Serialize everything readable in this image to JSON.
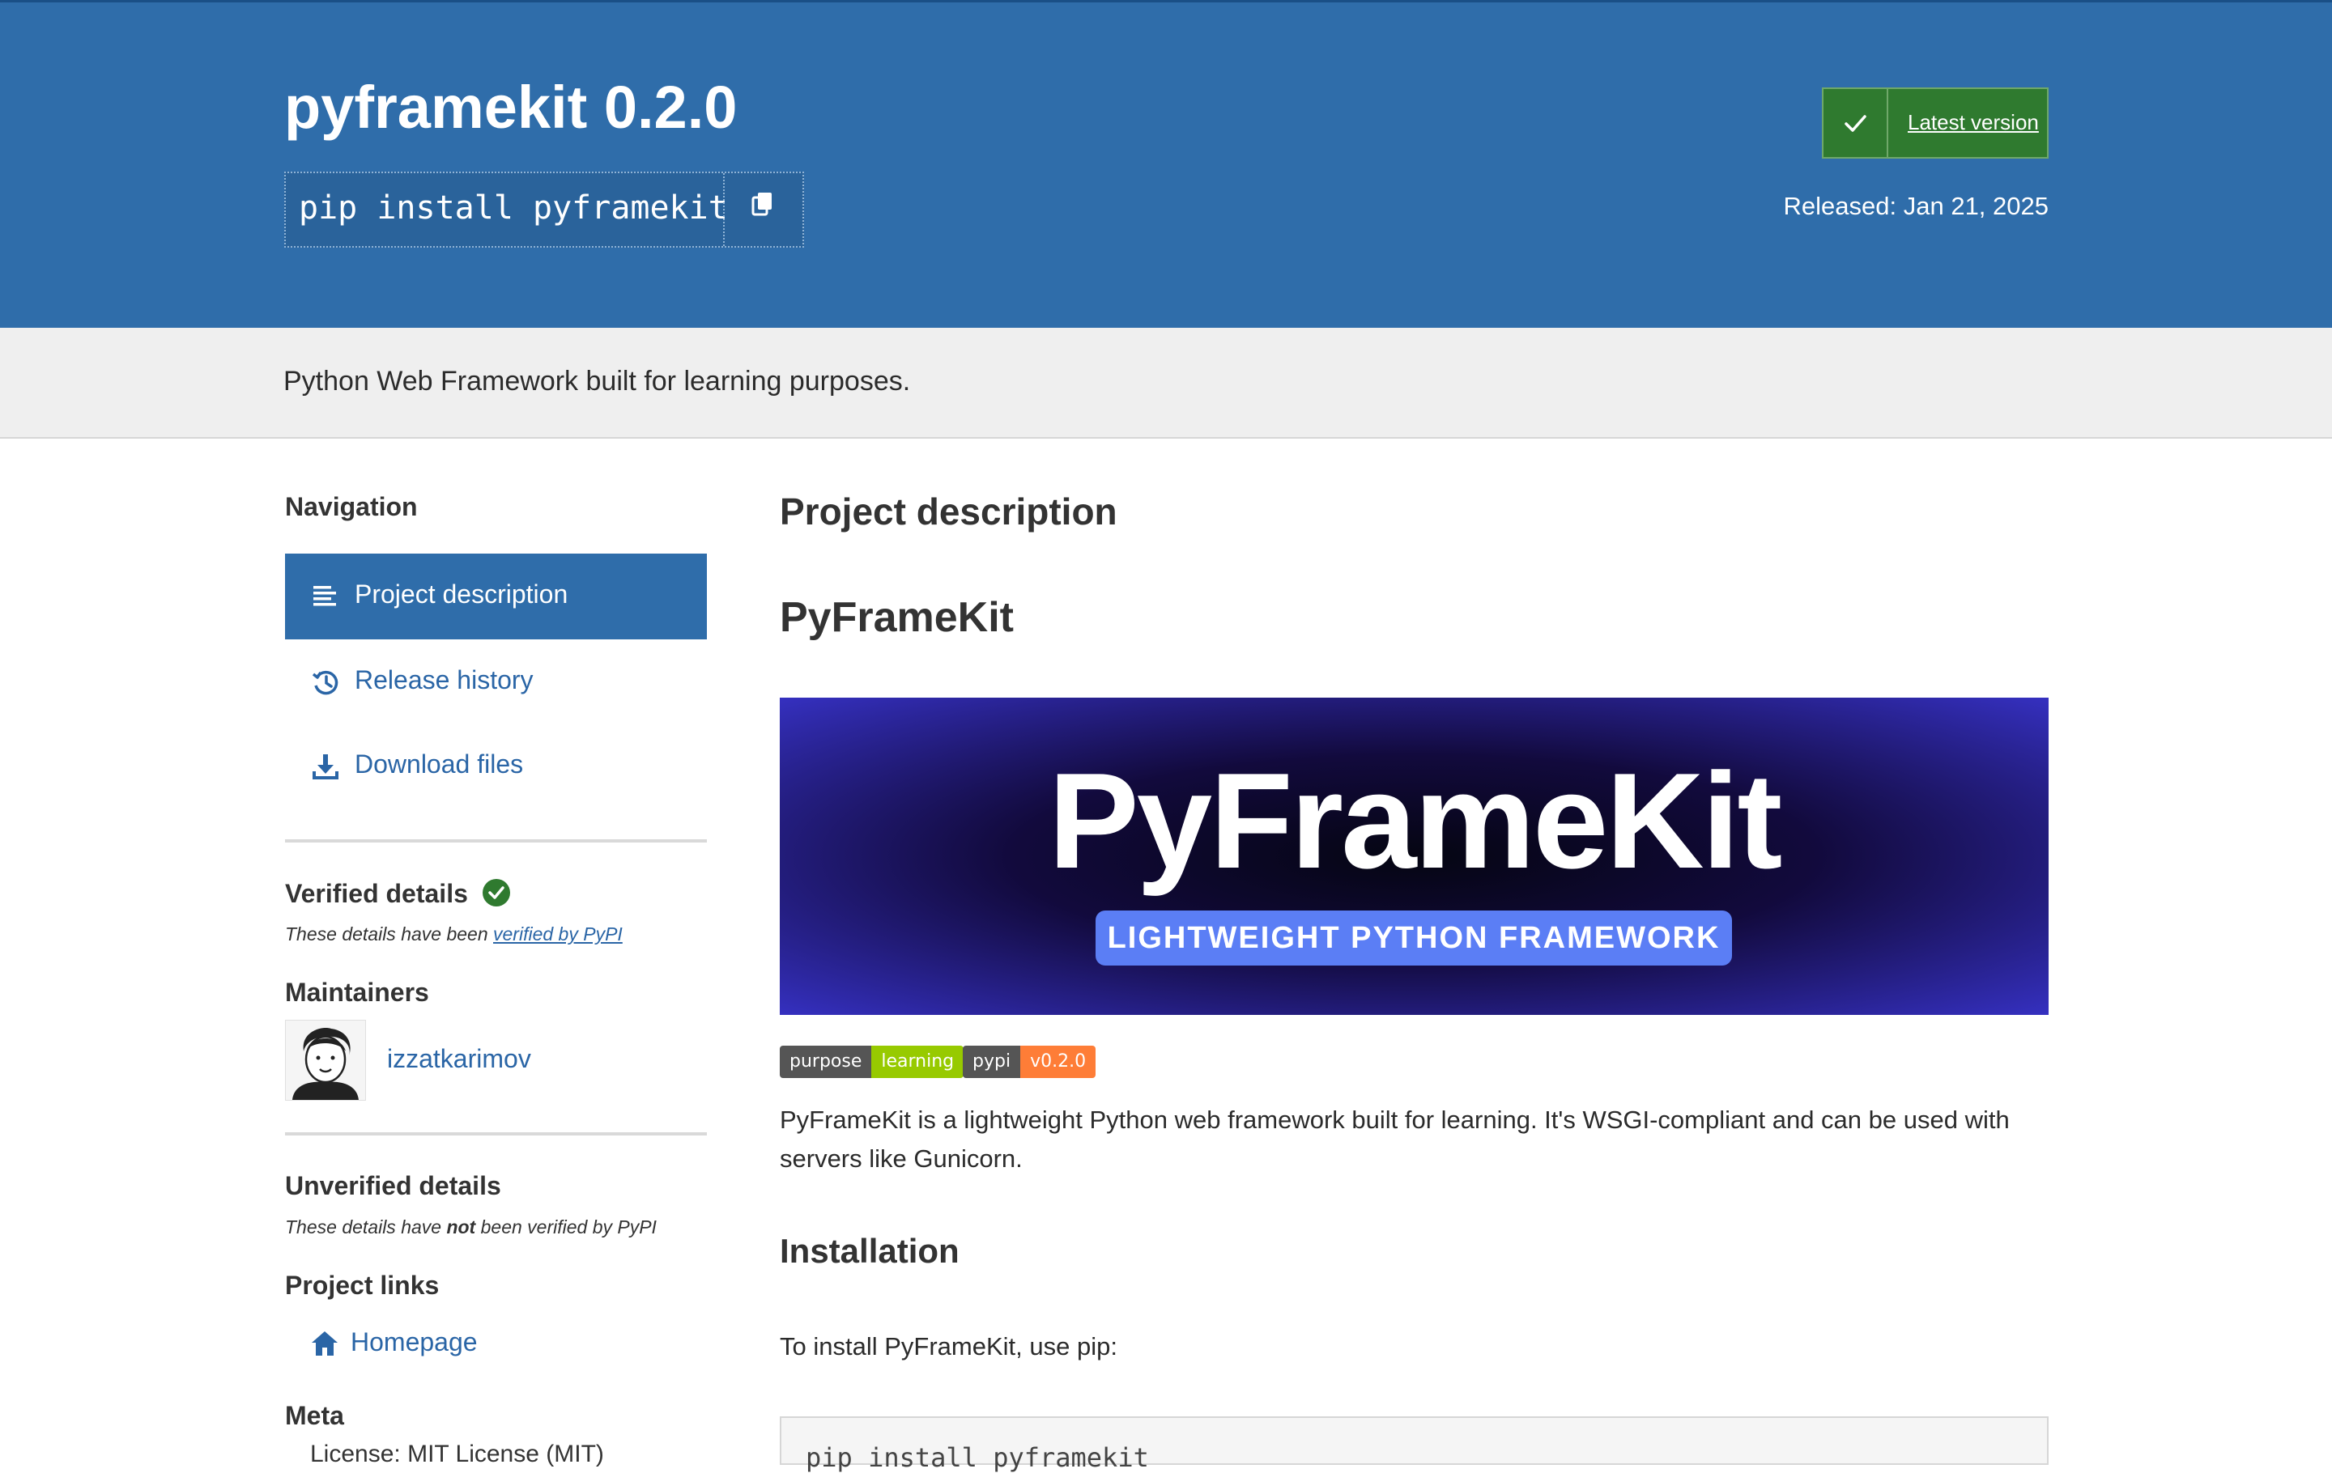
{
  "header": {
    "title": "pyframekit 0.2.0",
    "pip_command": "pip install pyframekit",
    "latest_version_label": "Latest version",
    "released": "Released: Jan 21, 2025"
  },
  "summary": "Python Web Framework built for learning purposes.",
  "sidebar": {
    "navigation_heading": "Navigation",
    "nav_items": [
      {
        "label": "Project description",
        "icon": "align-left-icon",
        "active": true
      },
      {
        "label": "Release history",
        "icon": "history-icon",
        "active": false
      },
      {
        "label": "Download files",
        "icon": "download-icon",
        "active": false
      }
    ],
    "verified_heading": "Verified details",
    "verified_note_prefix": "These details have been ",
    "verified_note_link": "verified by PyPI",
    "maintainers_heading": "Maintainers",
    "maintainer": "izzatkarimov",
    "unverified_heading": "Unverified details",
    "unverified_note_prefix": "These details have ",
    "unverified_note_bold": "not",
    "unverified_note_suffix": " been verified by PyPI",
    "project_links_heading": "Project links",
    "homepage_label": "Homepage",
    "meta_heading": "Meta",
    "meta_license": "License: MIT License (MIT)"
  },
  "main": {
    "section_title": "Project description",
    "readme_title": "PyFrameKit",
    "banner_title": "PyFrameKit",
    "banner_subtitle": "LIGHTWEIGHT PYTHON FRAMEWORK",
    "badges": [
      {
        "left": "purpose",
        "right": "learning",
        "color": "#97ca00"
      },
      {
        "left": "pypi",
        "right": "v0.2.0",
        "color": "#fe7d37"
      }
    ],
    "intro_line1": "PyFrameKit is a lightweight Python web framework built for learning. It's WSGI-compliant and can be used with",
    "intro_line2": "servers like Gunicorn.",
    "installation_heading": "Installation",
    "install_text": "To install PyFrameKit, use pip:",
    "install_code": "pip install pyframekit"
  },
  "colors": {
    "header_blue": "#2f6daa",
    "link_blue": "#2a65a6",
    "verified_green": "#2f7a2f",
    "badge_gray": "#555555"
  }
}
